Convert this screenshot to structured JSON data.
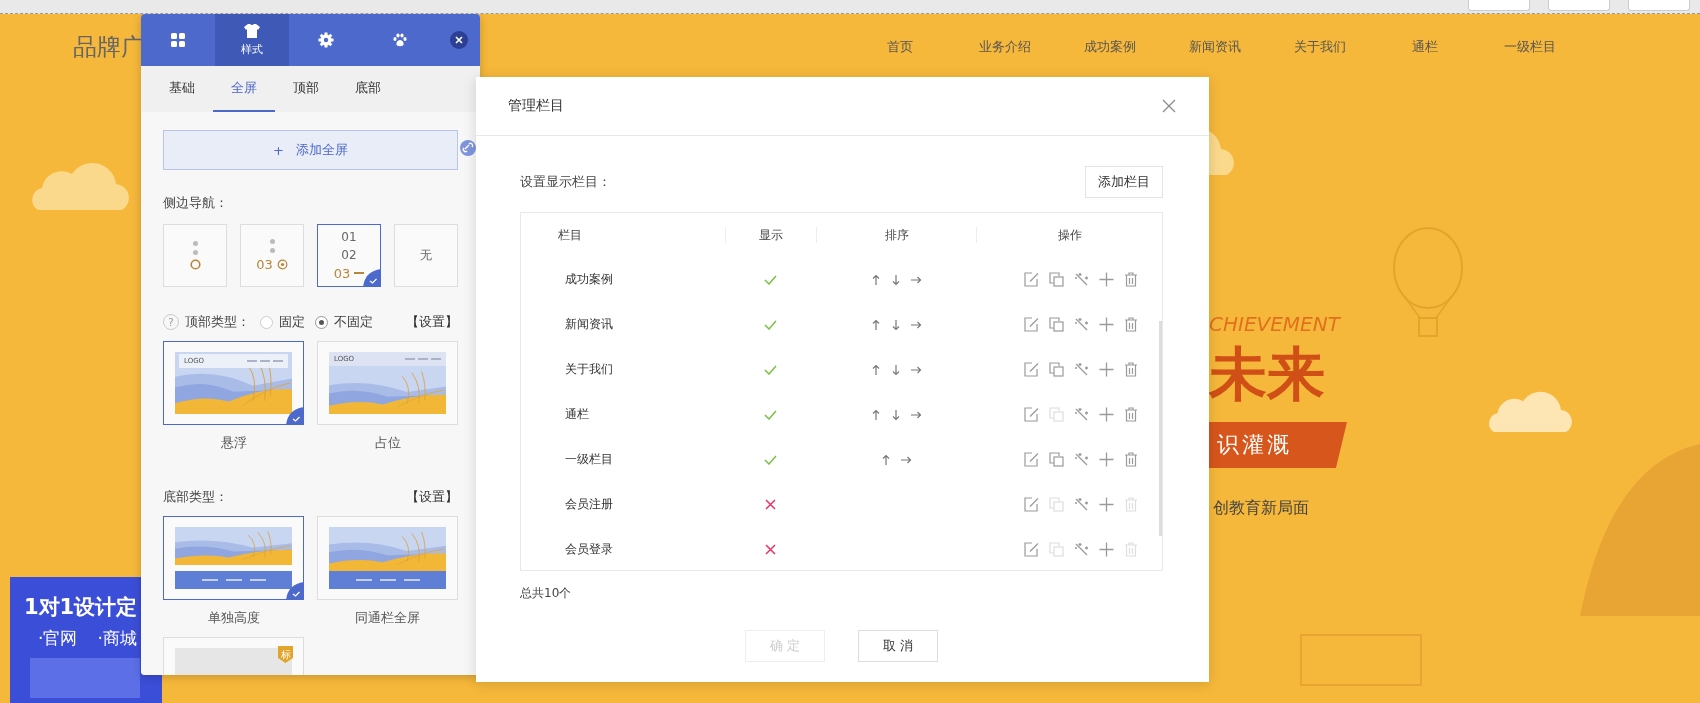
{
  "top_bar": {
    "buttons": [
      {
        "kind": "button"
      },
      {
        "kind": "button"
      },
      {
        "kind": "button"
      }
    ]
  },
  "site": {
    "logo": "品牌广",
    "nav": [
      "首页",
      "业务介绍",
      "成功案例",
      "新闻资讯",
      "关于我们",
      "通栏",
      "一级栏目"
    ],
    "banner": {
      "subtitle": "CHIEVEMENT",
      "headline": "未来",
      "ribbon": "识灌溉",
      "tagline": "创教育新局面"
    },
    "ad": {
      "title": "1对1设计定",
      "items": [
        "·官网",
        "·商城"
      ]
    }
  },
  "editor_panel": {
    "tabs": [
      {
        "kind": "grid",
        "selected": false
      },
      {
        "kind": "shirt",
        "label": "样式",
        "selected": true
      },
      {
        "kind": "gear",
        "selected": false
      },
      {
        "kind": "paw",
        "selected": false
      }
    ],
    "subtabs": [
      {
        "label": "基础",
        "selected": false
      },
      {
        "label": "全屏",
        "selected": true
      },
      {
        "label": "顶部",
        "selected": false
      },
      {
        "label": "底部",
        "selected": false
      }
    ],
    "add_button": {
      "icon": "+",
      "label": "添加全屏"
    },
    "side_nav": {
      "label": "侧边导航：",
      "options": [
        {
          "kind": "dots",
          "selected": false
        },
        {
          "kind": "dot-number",
          "numbers": [
            "03"
          ],
          "selected": false
        },
        {
          "kind": "numbers",
          "numbers": [
            "01",
            "02",
            "03"
          ],
          "selected": true
        },
        {
          "kind": "text",
          "label": "无",
          "selected": false
        }
      ]
    },
    "header_type": {
      "help": "?",
      "label": "顶部类型：",
      "options": [
        {
          "label": "固定",
          "selected": false
        },
        {
          "label": "不固定",
          "selected": true
        }
      ],
      "settings": "【设置】",
      "layouts": [
        {
          "kind": "float",
          "logo": "LOGO",
          "label": "悬浮",
          "selected": true
        },
        {
          "kind": "place",
          "logo": "LOGO",
          "label": "占位",
          "selected": false
        }
      ]
    },
    "footer_type": {
      "label": "底部类型：",
      "settings": "【设置】",
      "layouts": [
        {
          "kind": "separate",
          "label": "单独高度",
          "selected": true
        },
        {
          "kind": "full",
          "label": "同通栏全屏",
          "selected": false
        },
        {
          "kind": "badge",
          "badge": "标",
          "selected": false
        }
      ]
    }
  },
  "dialog": {
    "title": "管理栏目",
    "toolbar_label": "设置显示栏目：",
    "add_button": "添加栏目",
    "columns": [
      "栏目",
      "显示",
      "排序",
      "操作"
    ],
    "rows": [
      {
        "name": "成功案例",
        "visible": true,
        "can_move_up": true,
        "can_move_down": true,
        "can_move_right": true,
        "can_copy": true,
        "can_delete": true
      },
      {
        "name": "新闻资讯",
        "visible": true,
        "can_move_up": true,
        "can_move_down": true,
        "can_move_right": true,
        "can_copy": true,
        "can_delete": true
      },
      {
        "name": "关于我们",
        "visible": true,
        "can_move_up": true,
        "can_move_down": true,
        "can_move_right": true,
        "can_copy": true,
        "can_delete": true
      },
      {
        "name": "通栏",
        "visible": true,
        "can_move_up": true,
        "can_move_down": true,
        "can_move_right": true,
        "can_copy": false,
        "can_delete": true
      },
      {
        "name": "一级栏目",
        "visible": true,
        "can_move_up": true,
        "can_move_down": false,
        "can_move_right": true,
        "can_copy": true,
        "can_delete": true
      },
      {
        "name": "会员注册",
        "visible": false,
        "can_move_up": false,
        "can_move_down": false,
        "can_move_right": false,
        "can_copy": false,
        "can_delete": false
      },
      {
        "name": "会员登录",
        "visible": false,
        "can_move_up": false,
        "can_move_down": false,
        "can_move_right": false,
        "can_copy": false,
        "can_delete": false
      }
    ],
    "total": "总共10个",
    "buttons": [
      {
        "label": "确 定",
        "disabled": true
      },
      {
        "label": "取 消",
        "disabled": false
      }
    ]
  }
}
